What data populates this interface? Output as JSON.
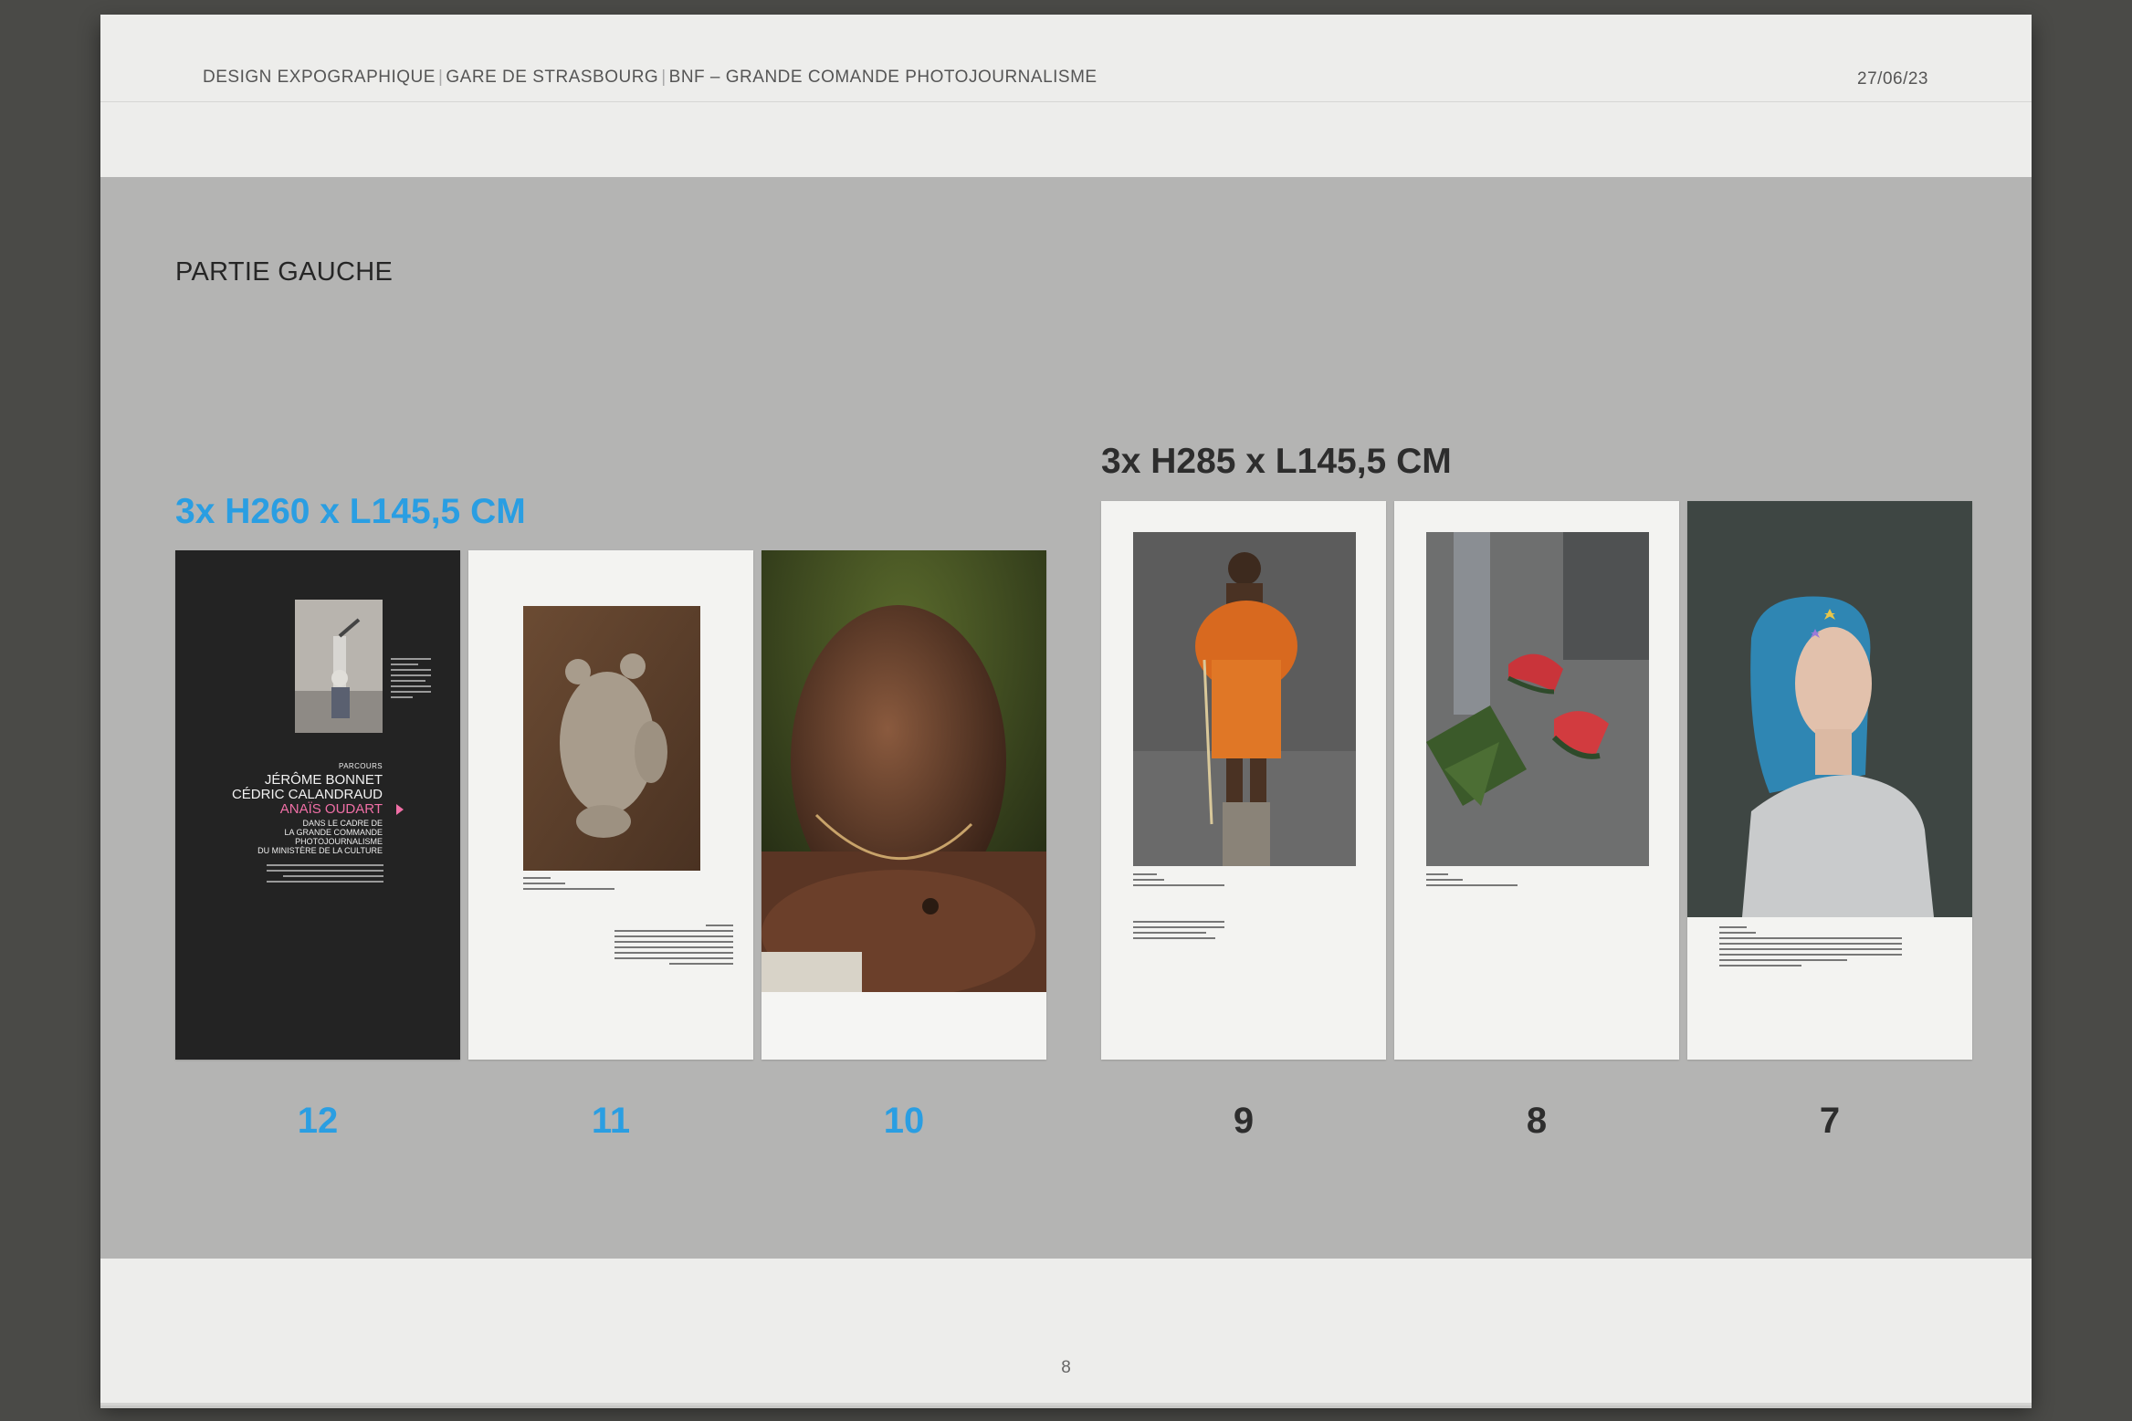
{
  "header": {
    "parts": [
      "DESIGN EXPOGRAPHIQUE",
      "GARE DE STRASBOURG",
      "BNF – GRANDE COMANDE PHOTOJOURNALISME"
    ],
    "date": "27/06/23"
  },
  "section_title": "PARTIE GAUCHE",
  "groups": {
    "left_dimensions": "3x H260 x L145,5 CM",
    "right_dimensions": "3x H285 x L145,5 CM"
  },
  "panels": [
    {
      "number": "12",
      "color": "#2a9ee2"
    },
    {
      "number": "11",
      "color": "#2a9ee2"
    },
    {
      "number": "10",
      "color": "#2a9ee2"
    },
    {
      "number": "9",
      "color": "#2d2d2d"
    },
    {
      "number": "8",
      "color": "#2d2d2d"
    },
    {
      "number": "7",
      "color": "#2d2d2d"
    }
  ],
  "panel12": {
    "label": "PARCOURS",
    "names": [
      "JÉRÔME BONNET",
      "CÉDRIC CALANDRAUD",
      "ANAÏS OUDART"
    ],
    "subtitle": "DANS LE CADRE DE\nLA GRANDE COMMANDE\nPHOTOJOURNALISME\nDU MINISTÈRE DE LA CULTURE"
  },
  "page_number": "8"
}
